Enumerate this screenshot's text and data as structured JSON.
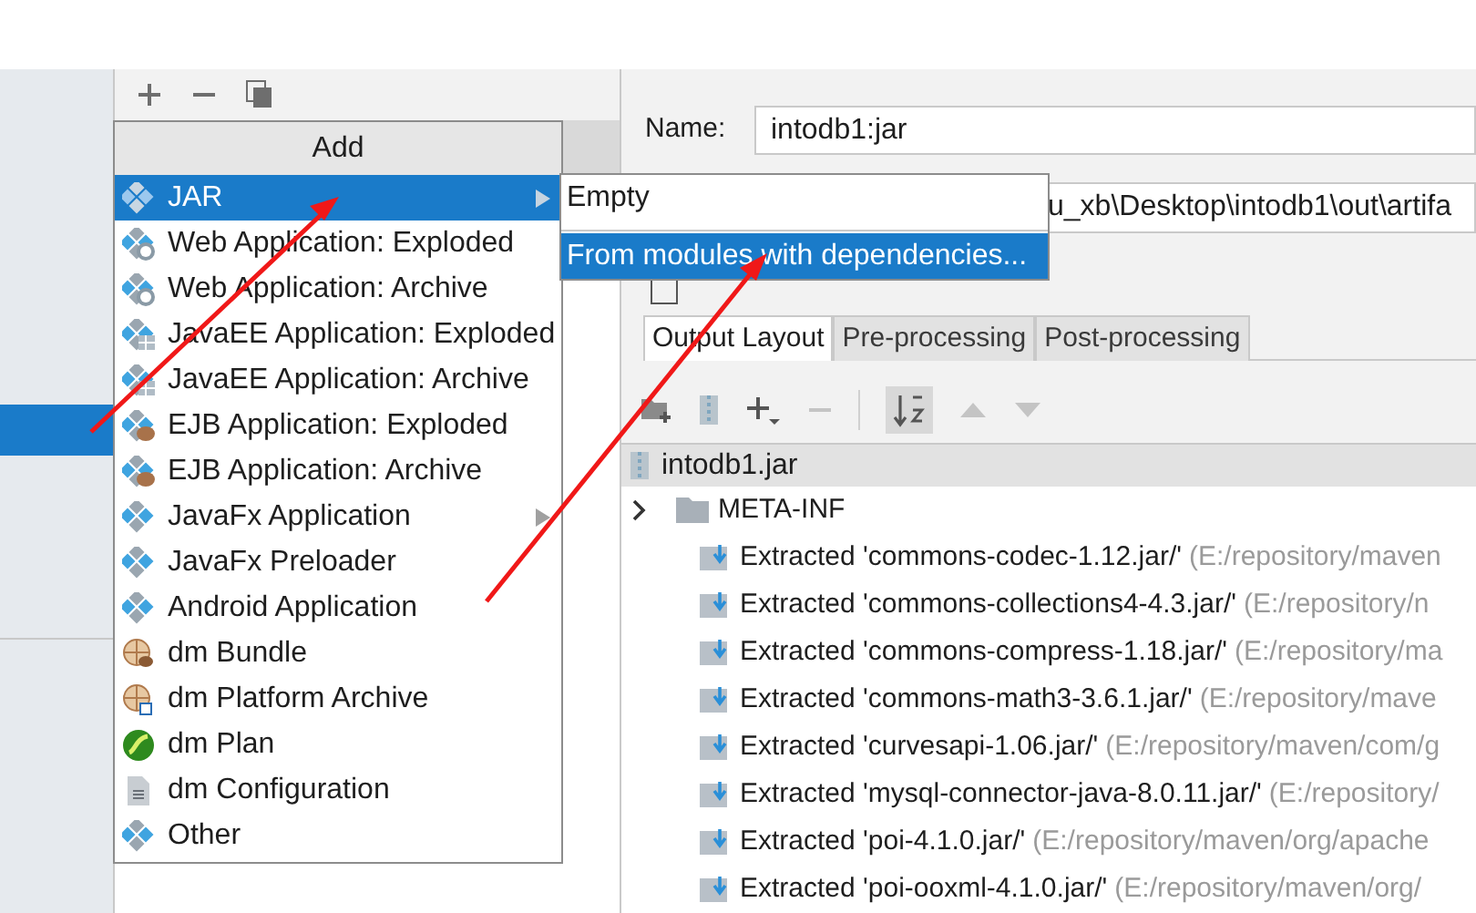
{
  "add_menu": {
    "title": "Add",
    "items": [
      {
        "label": "JAR",
        "kind": "module",
        "selected": true,
        "has_submenu": true
      },
      {
        "label": "Web Application: Exploded",
        "kind": "web",
        "selected": false,
        "has_submenu": false
      },
      {
        "label": "Web Application: Archive",
        "kind": "web",
        "selected": false,
        "has_submenu": false
      },
      {
        "label": "JavaEE Application: Exploded",
        "kind": "javaee",
        "selected": false,
        "has_submenu": false
      },
      {
        "label": "JavaEE Application: Archive",
        "kind": "javaee",
        "selected": false,
        "has_submenu": false
      },
      {
        "label": "EJB Application: Exploded",
        "kind": "ejb",
        "selected": false,
        "has_submenu": false
      },
      {
        "label": "EJB Application: Archive",
        "kind": "ejb",
        "selected": false,
        "has_submenu": false
      },
      {
        "label": "JavaFx Application",
        "kind": "module",
        "selected": false,
        "has_submenu": true
      },
      {
        "label": "JavaFx Preloader",
        "kind": "module",
        "selected": false,
        "has_submenu": false
      },
      {
        "label": "Android Application",
        "kind": "module",
        "selected": false,
        "has_submenu": false
      },
      {
        "label": "dm Bundle",
        "kind": "bundle",
        "selected": false,
        "has_submenu": false
      },
      {
        "label": "dm Platform Archive",
        "kind": "platform",
        "selected": false,
        "has_submenu": false
      },
      {
        "label": "dm Plan",
        "kind": "plan",
        "selected": false,
        "has_submenu": false
      },
      {
        "label": "dm Configuration",
        "kind": "config",
        "selected": false,
        "has_submenu": false
      },
      {
        "label": "Other",
        "kind": "module",
        "selected": false,
        "has_submenu": false
      }
    ]
  },
  "submenu": {
    "items": [
      {
        "label": "Empty",
        "selected": false
      },
      {
        "label": "From modules with dependencies...",
        "selected": true
      }
    ]
  },
  "name_field": {
    "label": "Name:",
    "value": "intodb1:jar"
  },
  "output_directory": {
    "value": "u_xb\\Desktop\\intodb1\\out\\artifa"
  },
  "include_in_build": {
    "checked": false
  },
  "tabs": [
    {
      "label": "Output Layout",
      "selected": true
    },
    {
      "label": "Pre-processing",
      "selected": false
    },
    {
      "label": "Post-processing",
      "selected": false
    }
  ],
  "layout_tree": {
    "root": "intodb1.jar",
    "children": [
      {
        "kind": "folder",
        "name": "META-INF"
      },
      {
        "kind": "extracted",
        "name": "Extracted 'commons-codec-1.12.jar/'",
        "path": "(E:/repository/maven"
      },
      {
        "kind": "extracted",
        "name": "Extracted 'commons-collections4-4.3.jar/'",
        "path": "(E:/repository/n"
      },
      {
        "kind": "extracted",
        "name": "Extracted 'commons-compress-1.18.jar/'",
        "path": "(E:/repository/ma"
      },
      {
        "kind": "extracted",
        "name": "Extracted 'commons-math3-3.6.1.jar/'",
        "path": "(E:/repository/mave"
      },
      {
        "kind": "extracted",
        "name": "Extracted 'curvesapi-1.06.jar/'",
        "path": "(E:/repository/maven/com/g"
      },
      {
        "kind": "extracted",
        "name": "Extracted 'mysql-connector-java-8.0.11.jar/'",
        "path": "(E:/repository/"
      },
      {
        "kind": "extracted",
        "name": "Extracted 'poi-4.1.0.jar/'",
        "path": "(E:/repository/maven/org/apache"
      },
      {
        "kind": "extracted",
        "name": "Extracted 'poi-ooxml-4.1.0.jar/'",
        "path": "(E:/repository/maven/org/"
      }
    ]
  }
}
